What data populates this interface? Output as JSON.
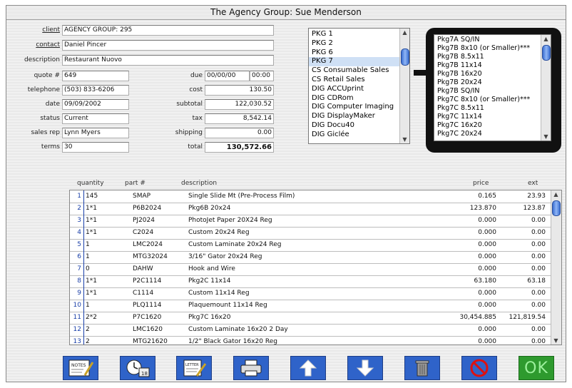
{
  "window": {
    "title": "The Agency Group: Sue Menderson"
  },
  "form": {
    "client_label": "client",
    "client_value": "AGENCY GROUP: 295",
    "contact_label": "contact",
    "contact_value": "Daniel Pincer",
    "description_label": "description",
    "description_value": "Restaurant Nuovo",
    "quote_label": "quote #",
    "quote_value": "649",
    "telephone_label": "telephone",
    "telephone_value": "(503) 833-6206",
    "date_label": "date",
    "date_value": "09/09/2002",
    "status_label": "status",
    "status_value": "Current",
    "salesrep_label": "sales rep",
    "salesrep_value": "Lynn Myers",
    "terms_label": "terms",
    "terms_value": "30",
    "due_label": "due",
    "due_date": "00/00/00",
    "due_time": "00:00",
    "cost_label": "cost",
    "cost_value": "130.50",
    "subtotal_label": "subtotal",
    "subtotal_value": "122,030.52",
    "tax_label": "tax",
    "tax_value": "8,542.14",
    "shipping_label": "shipping",
    "shipping_value": "0.00",
    "total_label": "total",
    "total_value": "130,572.66"
  },
  "category_list": {
    "items": [
      {
        "label": "PKG 1"
      },
      {
        "label": "PKG 2"
      },
      {
        "label": "PKG 6"
      },
      {
        "label": "PKG 7"
      },
      {
        "label": "CS Consumable Sales"
      },
      {
        "label": "CS Retail Sales"
      },
      {
        "label": "DIG ACCUprint"
      },
      {
        "label": "DIG CDRom"
      },
      {
        "label": "DIG Computer Imaging"
      },
      {
        "label": "DIG DisplayMaker"
      },
      {
        "label": "DIG Docu40"
      },
      {
        "label": "DIG Giclée"
      }
    ],
    "selected": "PKG 7"
  },
  "product_list": {
    "items": [
      {
        "label": "Pkg7A SQ/IN"
      },
      {
        "label": "Pkg7B   8x10 (or Smaller)***"
      },
      {
        "label": "Pkg7B  8.5x11"
      },
      {
        "label": "Pkg7B 11x14"
      },
      {
        "label": "Pkg7B 16x20"
      },
      {
        "label": "Pkg7B 20x24"
      },
      {
        "label": "Pkg7B SQ/IN"
      },
      {
        "label": "Pkg7C   8x10 (or Smaller)***"
      },
      {
        "label": "Pkg7C  8.5x11"
      },
      {
        "label": "Pkg7C 11x14"
      },
      {
        "label": "Pkg7C 16x20"
      },
      {
        "label": "Pkg7C 20x24"
      }
    ]
  },
  "table": {
    "headers": {
      "quantity": "quantity",
      "part": "part #",
      "description": "description",
      "price": "price",
      "ext": "ext"
    },
    "rows": [
      {
        "n": "1",
        "qty": "145",
        "part": "SMAP",
        "desc": "Single Slide Mt (Pre-Process Film)",
        "price": "0.165",
        "ext": "23.93"
      },
      {
        "n": "2",
        "qty": "1*1",
        "part": "P6B2024",
        "desc": " Pkg6B 20x24",
        "price": "123.870",
        "ext": "123.87"
      },
      {
        "n": "3",
        "qty": "1*1",
        "part": "PJ2024",
        "desc": "PhotoJet Paper 20X24 Reg",
        "price": "0.000",
        "ext": "0.00"
      },
      {
        "n": "4",
        "qty": "1*1",
        "part": "C2024",
        "desc": "Custom 20x24 Reg",
        "price": "0.000",
        "ext": "0.00"
      },
      {
        "n": "5",
        "qty": "1",
        "part": "LMC2024",
        "desc": "Custom Laminate 20x24 Reg",
        "price": "0.000",
        "ext": "0.00"
      },
      {
        "n": "6",
        "qty": "1",
        "part": "MTG32024",
        "desc": "3/16\" Gator 20x24 Reg",
        "price": "0.000",
        "ext": "0.00"
      },
      {
        "n": "7",
        "qty": "0",
        "part": "DAHW",
        "desc": "Hook and Wire",
        "price": "0.000",
        "ext": "0.00"
      },
      {
        "n": "8",
        "qty": "1*1",
        "part": "P2C1114",
        "desc": " Pkg2C 11x14",
        "price": "63.180",
        "ext": "63.18"
      },
      {
        "n": "9",
        "qty": "1*1",
        "part": "C1114",
        "desc": "Custom 11x14 Reg",
        "price": "0.000",
        "ext": "0.00"
      },
      {
        "n": "10",
        "qty": "1",
        "part": "PLQ1114",
        "desc": "Plaquemount 11x14 Reg",
        "price": "0.000",
        "ext": "0.00"
      },
      {
        "n": "11",
        "qty": "2*2",
        "part": "P7C1620",
        "desc": " Pkg7C 16x20",
        "price": "30,454.885",
        "ext": "121,819.54"
      },
      {
        "n": "12",
        "qty": "2",
        "part": "LMC1620",
        "desc": "Custom Laminate 16x20 2 Day",
        "price": "0.000",
        "ext": "0.00"
      },
      {
        "n": "13",
        "qty": "2",
        "part": "MTG21620",
        "desc": "1/2\" Black Gator 16x20 Reg",
        "price": "0.000",
        "ext": "0.00"
      }
    ]
  },
  "toolbar": {
    "notes_label": "NOTES",
    "calendar_label": "18",
    "letter_label": "LETTER",
    "ok_label": "OK"
  }
}
